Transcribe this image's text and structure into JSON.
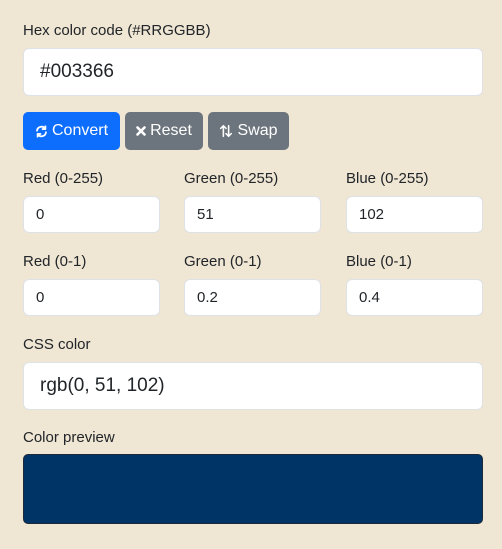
{
  "hex": {
    "label": "Hex color code (#RRGGBB)",
    "value": "#003366"
  },
  "buttons": {
    "convert_label": "Convert",
    "reset_label": "Reset",
    "swap_label": "Swap"
  },
  "rgb255": {
    "red_label": "Red (0-255)",
    "green_label": "Green (0-255)",
    "blue_label": "Blue (0-255)",
    "red_value": "0",
    "green_value": "51",
    "blue_value": "102"
  },
  "rgb01": {
    "red_label": "Red (0-1)",
    "green_label": "Green (0-1)",
    "blue_label": "Blue (0-1)",
    "red_value": "0",
    "green_value": "0.2",
    "blue_value": "0.4"
  },
  "css": {
    "label": "CSS color",
    "value": "rgb(0, 51, 102)"
  },
  "preview": {
    "label": "Color preview",
    "color": "#003366"
  },
  "icons": {
    "convert": "refresh-icon",
    "reset": "x-icon",
    "swap": "swap-vertical-icon"
  }
}
